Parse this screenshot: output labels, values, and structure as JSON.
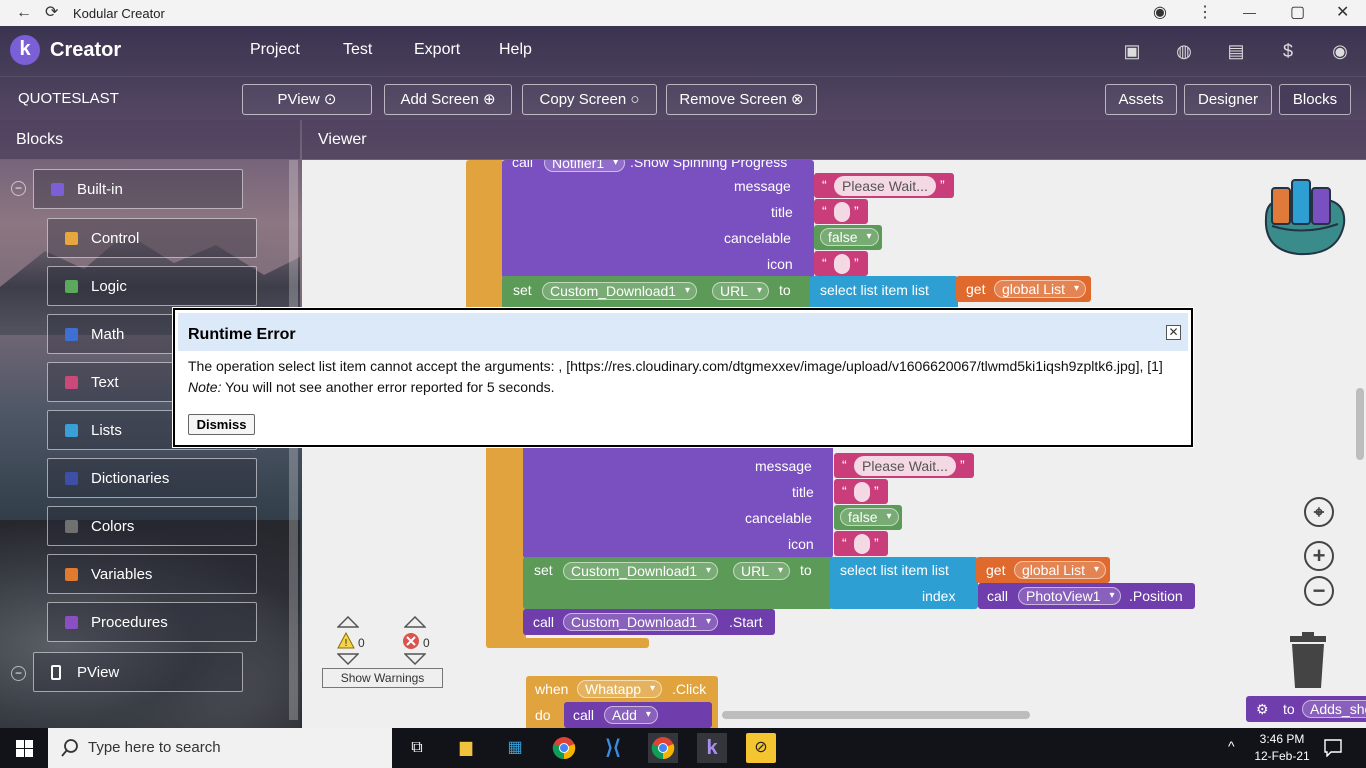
{
  "window": {
    "back": "←",
    "reload": "⟳",
    "title": "Kodular Creator",
    "minimize": "—",
    "maximize": "▢",
    "close": "✕",
    "privacy": "◉",
    "more": "⋮"
  },
  "topbar": {
    "logo_letter": "k",
    "brand": "Creator",
    "menu": [
      "Project",
      "Test",
      "Export",
      "Help"
    ]
  },
  "project": {
    "name": "QUOTESLAST",
    "buttons": [
      "PView ⊙",
      "Add Screen ⊕",
      "Copy Screen ○",
      "Remove Screen ⊗"
    ],
    "views": [
      "Assets",
      "Designer",
      "Blocks"
    ]
  },
  "panels": {
    "blocks": "Blocks",
    "viewer": "Viewer"
  },
  "sidebar": {
    "builtin": "Built-in",
    "categories": [
      {
        "label": "Control",
        "color": "#e8a73c"
      },
      {
        "label": "Logic",
        "color": "#5ca85c"
      },
      {
        "label": "Math",
        "color": "#3f6fd1"
      },
      {
        "label": "Text",
        "color": "#c94a7a"
      },
      {
        "label": "Lists",
        "color": "#3a9fd6"
      },
      {
        "label": "Dictionaries",
        "color": "#3e4fa6"
      },
      {
        "label": "Colors",
        "color": "#707070"
      },
      {
        "label": "Variables",
        "color": "#e07a2e"
      },
      {
        "label": "Procedures",
        "color": "#8a4fc3"
      }
    ],
    "screen": "PView"
  },
  "blocks": {
    "call1": "call",
    "notifier": "Notifier1",
    "show_spinning": ".Show Spinning Progress",
    "message": "message",
    "title": "title",
    "cancelable": "cancelable",
    "icon": "icon",
    "please_wait": "Please Wait...",
    "false_val": "false",
    "set": "set",
    "download": "Custom_Download1",
    "url": "URL",
    "to": "to",
    "select_list": "select list item  list",
    "get": "get",
    "global_list": "global List",
    "index": "index",
    "call": "call",
    "photoview": "PhotoView1",
    "position": ".Position",
    "start": ".Start",
    "when": "when",
    "whatapp": "Whatapp",
    "click": ".Click",
    "do": "do",
    "add": "Add",
    "to_adds": "to",
    "adds": "Adds_sho",
    "quote_open": "“",
    "quote_close": "”"
  },
  "dialog": {
    "title": "Runtime Error",
    "message": "The operation select list item cannot accept the arguments: , [https://res.cloudinary.com/dtgmexxev/image/upload/v1606620067/tlwmd5ki1iqsh9zpltk6.jpg], [1]",
    "note_label": "Note:",
    "note": " You will not see another error reported for 5 seconds.",
    "dismiss": "Dismiss",
    "close": "✕"
  },
  "warnings": {
    "warn_count": "0",
    "error_count": "0",
    "show_label": "Show Warnings"
  },
  "controls": {
    "target": "⌖",
    "zoom_in": "+",
    "zoom_out": "−",
    "trash": "🗑"
  },
  "taskbar": {
    "search_placeholder": "Type here to search",
    "time": "3:46 PM",
    "date": "12-Feb-21",
    "chevron": "^"
  }
}
